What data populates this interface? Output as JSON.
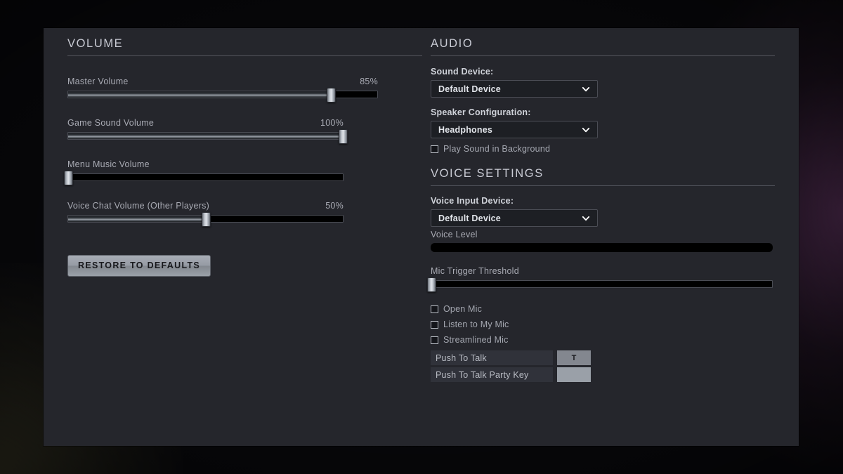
{
  "volume_section": {
    "title": "VOLUME",
    "sliders": [
      {
        "label": "Master Volume",
        "value_label": "85%",
        "percent": 85,
        "track_width": 442,
        "has_value": true
      },
      {
        "label": "Game Sound Volume",
        "value_label": "100%",
        "percent": 100,
        "track_width": 393,
        "has_value": true
      },
      {
        "label": "Menu Music Volume",
        "value_label": "",
        "percent": 0,
        "track_width": 393,
        "has_value": false
      },
      {
        "label": "Voice Chat Volume (Other Players)",
        "value_label": "50%",
        "percent": 50,
        "track_width": 393,
        "has_value": true
      }
    ],
    "restore_button": "RESTORE TO DEFAULTS"
  },
  "audio_section": {
    "title": "AUDIO",
    "sound_device": {
      "label": "Sound Device:",
      "value": "Default Device",
      "icon": "chevron-down-icon"
    },
    "speaker_configuration": {
      "label": "Speaker Configuration:",
      "value": "Headphones",
      "icon": "chevron-down-icon"
    },
    "play_sound_in_background": {
      "label": "Play Sound in Background",
      "checked": false
    }
  },
  "voice_section": {
    "title": "VOICE SETTINGS",
    "voice_input_device": {
      "label": "Voice Input Device:",
      "value": "Default Device",
      "icon": "chevron-down-icon"
    },
    "voice_level": {
      "label": "Voice Level",
      "percent": 0
    },
    "mic_trigger_threshold": {
      "label": "Mic Trigger Threshold",
      "percent": 0,
      "track_width": 487
    },
    "checkboxes": [
      {
        "label": "Open Mic",
        "checked": false
      },
      {
        "label": "Listen to My Mic",
        "checked": false
      },
      {
        "label": "Streamlined Mic",
        "checked": false
      }
    ],
    "keybinds": [
      {
        "name": "Push To Talk",
        "key": "T"
      },
      {
        "name": "Push To Talk Party Key",
        "key": ""
      }
    ]
  },
  "colors": {
    "panel_background": "#25262c",
    "page_background": "#08080b",
    "header_text": "#c9cbd4",
    "label_text": "#a9abb4",
    "field_label_text": "#cfd2d9",
    "dropdown_background": "#1d1f24",
    "handle_highlight": "#dfe3e9",
    "button_face": "#969ba4",
    "accent_purple": "#4e2a4e",
    "accent_olive": "#3a3826"
  }
}
